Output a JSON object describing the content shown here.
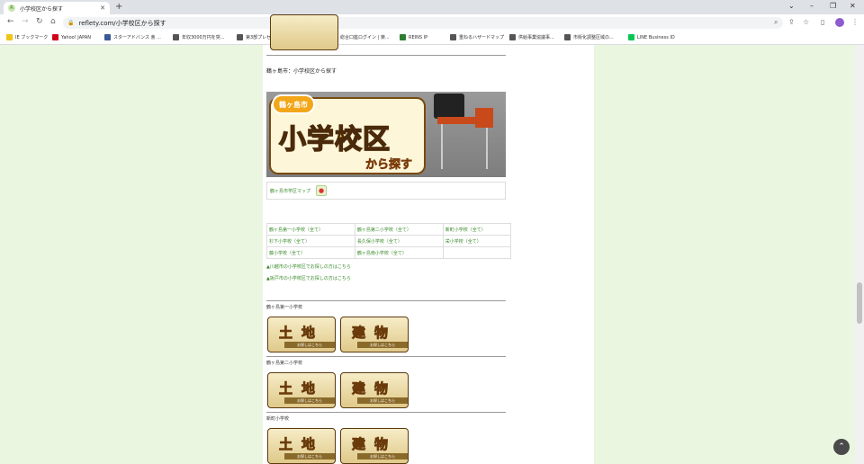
{
  "browser": {
    "tab_title": "小学校区から探す",
    "tab_favicon": "R",
    "url": "reflety.com/小学校区から探す",
    "bookmarks": [
      {
        "label": "IE ブックマーク",
        "color": "#f0c419"
      },
      {
        "label": "Yahoo! JAPAN",
        "color": "#d0021b"
      },
      {
        "label": "スターアドバンス 會 ...",
        "color": "#3b5998"
      },
      {
        "label": "年収3000万円を突...",
        "color": "#555555"
      },
      {
        "label": "第3部プレゼント",
        "color": "#555555"
      },
      {
        "label": "みずほ証券",
        "color": "#1a237e"
      },
      {
        "label": "総合口座ログイン | 楽...",
        "color": "#bf0000"
      },
      {
        "label": "REINS IP",
        "color": "#2e7d32"
      },
      {
        "label": "重ねるハザードマップ",
        "color": "#555555"
      },
      {
        "label": "供給事業協議事...",
        "color": "#555555"
      },
      {
        "label": "市街化調整区域の...",
        "color": "#555555"
      },
      {
        "label": "LINE Business ID",
        "color": "#06c755"
      }
    ]
  },
  "page": {
    "heading": "鶴ヶ島市：小学校区から探す",
    "banner": {
      "city": "鶴ヶ島市",
      "title": "小学校区",
      "subtitle": "から探す"
    },
    "map_link": "鶴ヶ島市学区マップ",
    "schools": [
      [
        "鶴ヶ島第一小学校（全て）",
        "鶴ヶ島第二小学校（全て）",
        "新町小学校（全て）"
      ],
      [
        "杉下小学校（全て）",
        "長久保小学校（全て）",
        "栄小学校（全て）"
      ],
      [
        "藤小学校（全て）",
        "鶴ヶ島南小学校（全て）",
        ""
      ]
    ],
    "links": [
      "▲川越市の小学校区でお探しの方はこちら",
      "▲坂戸市の小学校区でお探しの方はこちら"
    ],
    "sections": [
      {
        "label": "鶴ヶ島第一小学校"
      },
      {
        "label": "鶴ヶ島第二小学校"
      },
      {
        "label": "新町小学校"
      }
    ],
    "land_label": "土地",
    "building_label": "建物",
    "strip_text": "お探しはこちら"
  }
}
